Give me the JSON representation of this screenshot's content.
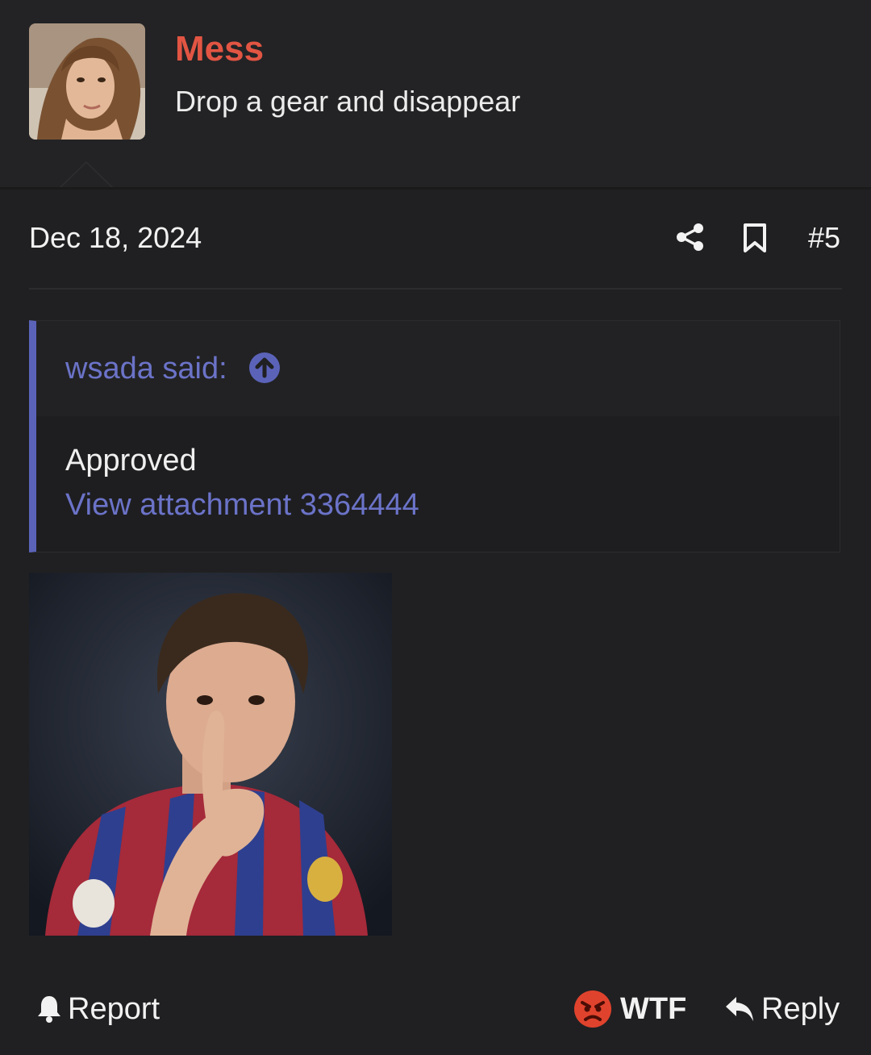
{
  "post": {
    "username": "Mess",
    "user_title": "Drop a gear and disappear",
    "date": "Dec 18, 2024",
    "post_number": "#5"
  },
  "quote": {
    "author": "wsada said:",
    "text": "Approved",
    "attachment_link": "View attachment 3364444"
  },
  "actions": {
    "report": "Report",
    "reaction": "WTF",
    "reply": "Reply"
  },
  "icons": [
    "share-icon",
    "bookmark-icon",
    "arrow-up-circle-icon",
    "bell-icon",
    "angry-face-icon",
    "reply-arrow-icon"
  ],
  "colors": {
    "background": "#202022",
    "username": "#e25543",
    "quote_accent": "#5b63b9",
    "link": "#6b73c8",
    "reaction": "#e0432d"
  }
}
